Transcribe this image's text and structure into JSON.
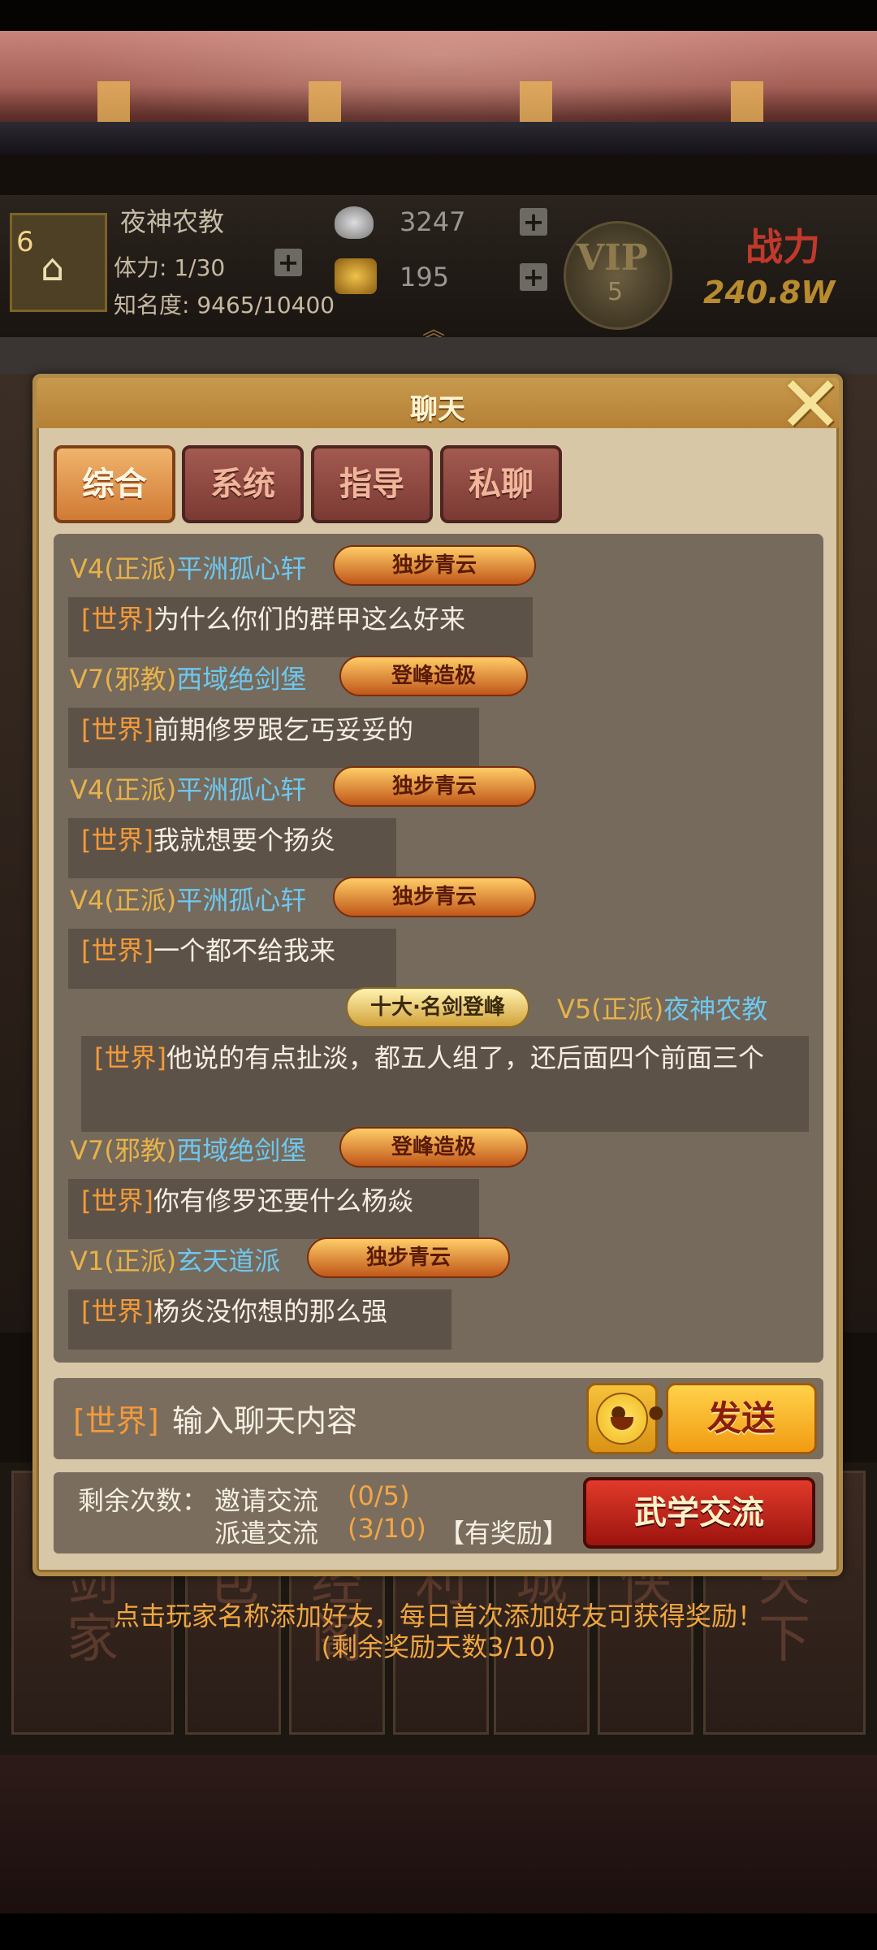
{
  "player": {
    "level": "6",
    "name": "夜神农教",
    "stamina": "体力: 1/30",
    "fame": "知名度: 9465/10400",
    "silver": "3247",
    "gold": "195",
    "vip_label": "VIP",
    "vip_level": "5",
    "power_label": "战力",
    "power_value": "240.8W"
  },
  "chat": {
    "title": "聊天",
    "tabs": [
      "综合",
      "系统",
      "指导",
      "私聊"
    ],
    "active_tab": "综合",
    "messages": [
      {
        "prefix": "V4(正派)",
        "player": "平洲孤心轩",
        "badge": "独步青云",
        "tag": "[世界]",
        "text": "为什么你们的群甲这么好来",
        "side": "left"
      },
      {
        "prefix": "V7(邪教)",
        "player": "西域绝剑堡",
        "badge": "登峰造极",
        "tag": "[世界]",
        "text": "前期修罗跟乞丐妥妥的",
        "side": "left"
      },
      {
        "prefix": "V4(正派)",
        "player": "平洲孤心轩",
        "badge": "独步青云",
        "tag": "[世界]",
        "text": "我就想要个扬炎",
        "side": "left"
      },
      {
        "prefix": "V4(正派)",
        "player": "平洲孤心轩",
        "badge": "独步青云",
        "tag": "[世界]",
        "text": "一个都不给我来",
        "side": "left"
      },
      {
        "prefix": "V5(正派)",
        "player": "夜神农教",
        "badge": "十大·名剑登峰",
        "tag": "[世界]",
        "text": "他说的有点扯淡，都五人组了，还后面四个前面三个",
        "side": "right"
      },
      {
        "prefix": "V7(邪教)",
        "player": "西域绝剑堡",
        "badge": "登峰造极",
        "tag": "[世界]",
        "text": "你有修罗还要什么杨焱",
        "side": "left"
      },
      {
        "prefix": "V1(正派)",
        "player": "玄天道派",
        "badge": "独步青云",
        "tag": "[世界]",
        "text": "杨炎没你想的那么强",
        "side": "left"
      }
    ],
    "input": {
      "channel": "[世界]",
      "placeholder": "输入聊天内容"
    },
    "send_label": "发送",
    "emoji_icon": "smiley-face-icon"
  },
  "exchange": {
    "remaining_label": "剩余次数：",
    "invite_label": "邀请交流",
    "invite_count": "(0/5)",
    "dispatch_label": "派遣交流",
    "dispatch_count": "(3/10)",
    "reward_note": "【有奖励】",
    "button_label": "武学交流"
  },
  "tips": {
    "line1": "点击玩家名称添加好友，每日首次添加好友可获得奖励！",
    "line2": "(剩余奖励天数3/10)"
  },
  "bottom_tiles": [
    "天\n剑\n家",
    "背\n包",
    "藏\n经\n阁",
    "福\n利",
    "商\n城",
    "寻\n侠",
    "剑\n天\n下"
  ],
  "colors": {
    "accent_orange": "#f39a3c",
    "player_blue": "#6ec7f0",
    "vip_gold": "#e8b24a",
    "panel_bg": "#d7c7a6"
  }
}
